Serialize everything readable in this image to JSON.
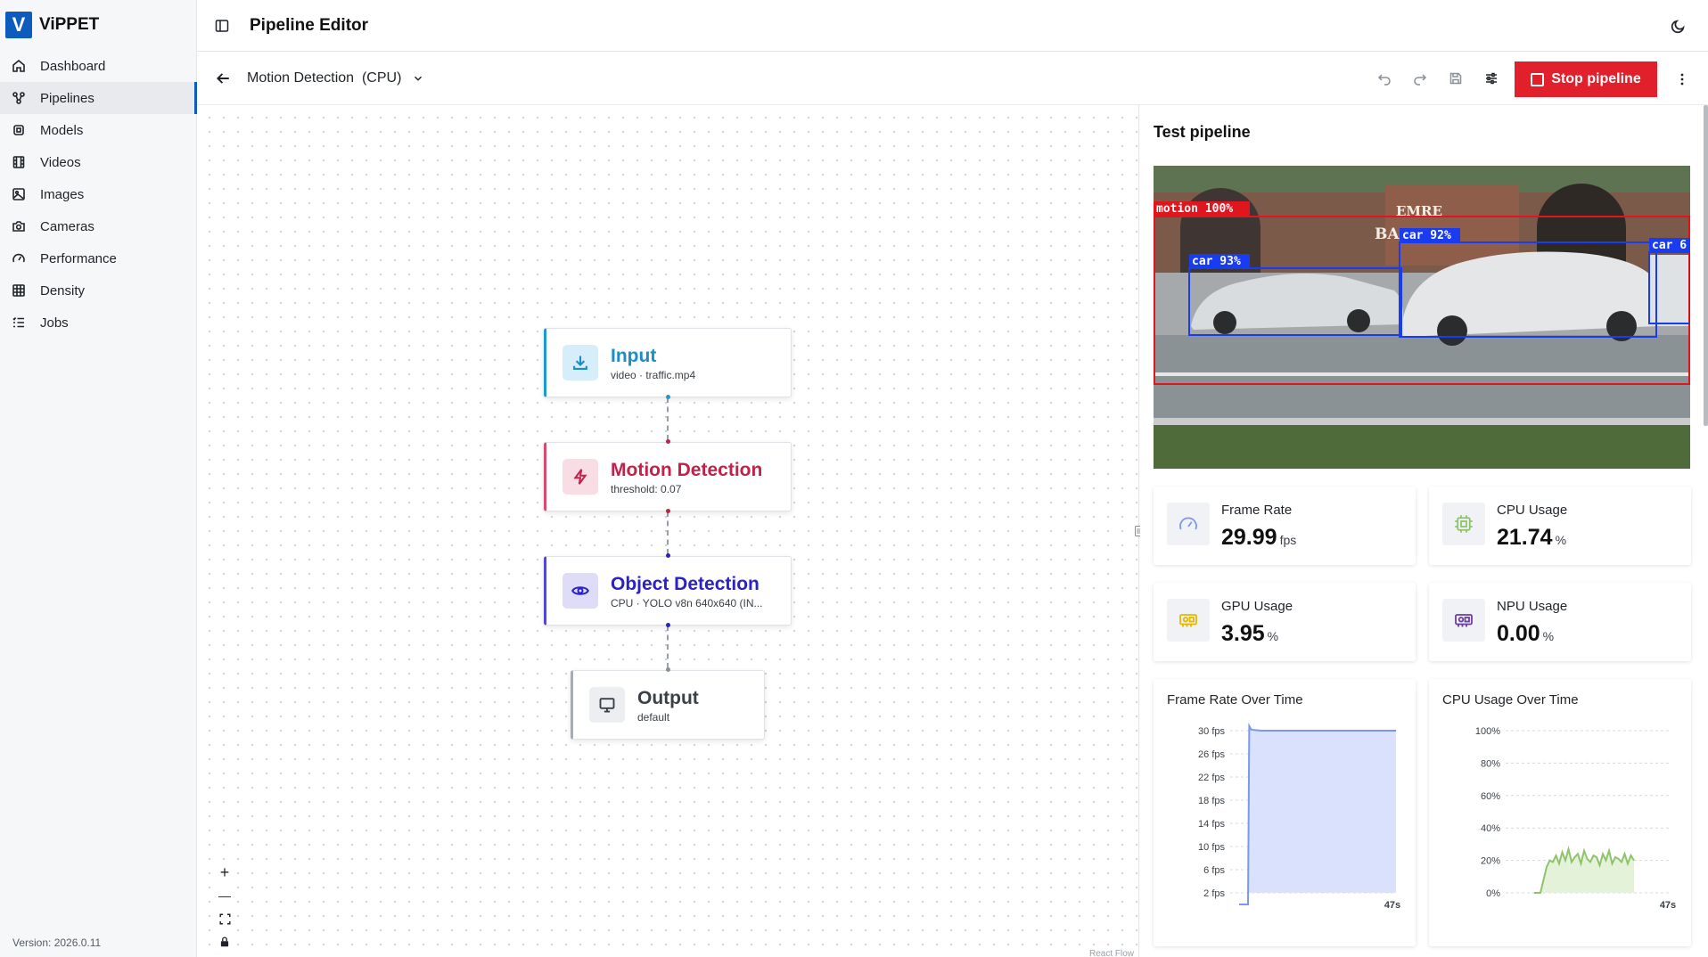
{
  "app": {
    "logo_letter": "V",
    "name": "ViPPET",
    "version": "Version: 2026.0.11"
  },
  "sidebar": {
    "items": [
      {
        "label": "Dashboard",
        "icon": "home-icon"
      },
      {
        "label": "Pipelines",
        "icon": "pipelines-icon",
        "active": true
      },
      {
        "label": "Models",
        "icon": "models-icon"
      },
      {
        "label": "Videos",
        "icon": "videos-icon"
      },
      {
        "label": "Images",
        "icon": "images-icon"
      },
      {
        "label": "Cameras",
        "icon": "camera-icon"
      },
      {
        "label": "Performance",
        "icon": "gauge-icon"
      },
      {
        "label": "Density",
        "icon": "grid-icon"
      },
      {
        "label": "Jobs",
        "icon": "list-icon"
      }
    ]
  },
  "header": {
    "title": "Pipeline Editor"
  },
  "toolbar": {
    "pipeline_name": "Motion Detection  (CPU)",
    "stop_label": "Stop pipeline",
    "stop_color": "#e2202c"
  },
  "nodes": [
    {
      "title": "Input",
      "subtitle": "video · traffic.mp4",
      "color": "#1a8fc7",
      "icon": "download-icon"
    },
    {
      "title": "Motion Detection",
      "subtitle": "threshold: 0.07",
      "color": "#c2224a",
      "icon": "bolt-icon"
    },
    {
      "title": "Object Detection",
      "subtitle": "CPU · YOLO v8n 640x640 (IN...",
      "color": "#2a21c8",
      "icon": "eye-icon"
    },
    {
      "title": "Output",
      "subtitle": "default",
      "color": "#3b4047",
      "icon": "monitor-icon"
    }
  ],
  "canvas": {
    "zoom_in": "+",
    "zoom_out": "—",
    "attribution": "React Flow"
  },
  "test_panel": {
    "title": "Test pipeline",
    "detections": [
      {
        "label": "motion 100%",
        "color": "#e0161e"
      },
      {
        "label": "car 93%",
        "color": "#1a3cf0"
      },
      {
        "label": "car 92%",
        "color": "#1a3cf0"
      },
      {
        "label": "car 6",
        "color": "#1a3cf0"
      }
    ],
    "scene_text": [
      "EMRE",
      "BA"
    ],
    "metrics": [
      {
        "label": "Frame Rate",
        "value": "29.99",
        "unit": "fps",
        "icon": "gauge-icon"
      },
      {
        "label": "CPU Usage",
        "value": "21.74",
        "unit": "%",
        "icon": "cpu-icon"
      },
      {
        "label": "GPU Usage",
        "value": "3.95",
        "unit": "%",
        "icon": "gpu-icon"
      },
      {
        "label": "NPU Usage",
        "value": "0.00",
        "unit": "%",
        "icon": "npu-icon"
      }
    ]
  },
  "chart_data": [
    {
      "type": "area",
      "title": "Frame Rate Over Time",
      "y_ticks": [
        "30 fps",
        "26 fps",
        "22 fps",
        "18 fps",
        "14 fps",
        "10 fps",
        "6 fps",
        "2 fps"
      ],
      "ylim": [
        0,
        31
      ],
      "x_label_last": "47s",
      "color": "#7b97f0",
      "fill": "#d9e1fc",
      "x": [
        0,
        1,
        1.4,
        2,
        3,
        5,
        10,
        20,
        30,
        40,
        47
      ],
      "y": [
        0,
        0,
        30.8,
        30.2,
        30.1,
        30.0,
        30.0,
        30.0,
        30.0,
        30.0,
        30.0
      ]
    },
    {
      "type": "area",
      "title": "CPU Usage Over Time",
      "y_ticks": [
        "100%",
        "80%",
        "60%",
        "40%",
        "20%",
        "0%"
      ],
      "ylim": [
        0,
        100
      ],
      "x_label_last": "47s",
      "color": "#8fc36b",
      "fill": "#e3f2d8",
      "x": [
        0,
        2,
        3,
        4,
        5,
        6,
        7,
        8,
        9,
        10,
        11,
        12,
        13,
        14,
        15,
        16,
        17,
        18,
        19,
        20,
        21,
        22,
        23,
        24,
        25,
        26,
        27,
        28,
        29,
        30,
        31,
        32
      ],
      "y": [
        0,
        0,
        8,
        16,
        20,
        19,
        23,
        18,
        25,
        20,
        27,
        19,
        22,
        24,
        18,
        26,
        21,
        19,
        23,
        22,
        17,
        24,
        20,
        26,
        18,
        22,
        21,
        19,
        24,
        18,
        23,
        20
      ]
    }
  ]
}
